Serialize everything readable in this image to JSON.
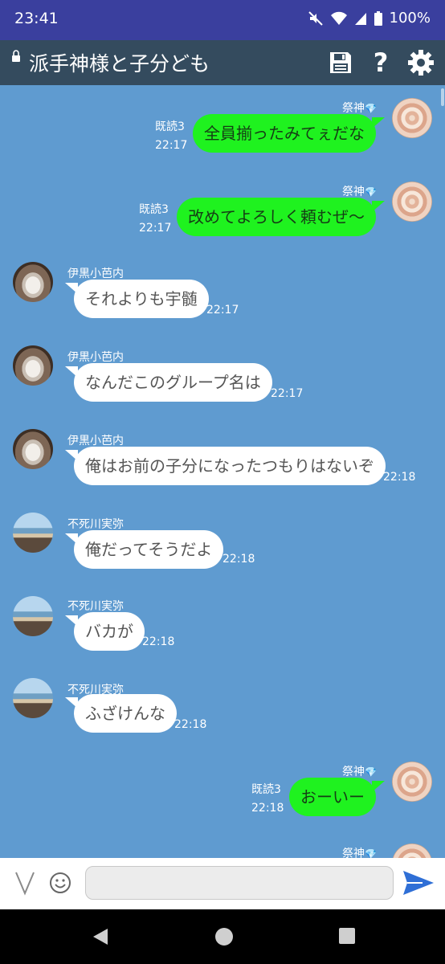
{
  "status_bar": {
    "time": "23:41",
    "battery": "100%"
  },
  "header": {
    "title": "派手神様と子分ども"
  },
  "messages": [
    {
      "type": "outgoing",
      "sender": "祭神",
      "gem": "💎",
      "text": "全員揃ったみてぇだな",
      "read": "既読3",
      "time": "22:17",
      "avatar": "flower"
    },
    {
      "type": "outgoing",
      "sender": "祭神",
      "gem": "💎",
      "text": "改めてよろしく頼むぜ〜",
      "read": "既読3",
      "time": "22:17",
      "avatar": "flower"
    },
    {
      "type": "incoming",
      "sender": "伊黒小芭内",
      "text": "それよりも宇髄",
      "time": "22:17",
      "avatar": "cup"
    },
    {
      "type": "incoming",
      "sender": "伊黒小芭内",
      "text": "なんだこのグループ名は",
      "time": "22:17",
      "avatar": "cup"
    },
    {
      "type": "incoming",
      "sender": "伊黒小芭内",
      "text": "俺はお前の子分になったつもりはないぞ",
      "time": "22:18",
      "avatar": "cup"
    },
    {
      "type": "incoming",
      "sender": "不死川実弥",
      "text": "俺だってそうだよ",
      "time": "22:18",
      "avatar": "beach"
    },
    {
      "type": "incoming",
      "sender": "不死川実弥",
      "text": "バカが",
      "time": "22:18",
      "avatar": "beach"
    },
    {
      "type": "incoming",
      "sender": "不死川実弥",
      "text": "ふざけんな",
      "time": "22:18",
      "avatar": "beach"
    },
    {
      "type": "outgoing",
      "sender": "祭神",
      "gem": "💎",
      "text": "おーいー",
      "read": "既読3",
      "time": "22:18",
      "avatar": "flower"
    },
    {
      "type": "outgoing-partial",
      "sender": "祭神",
      "gem": "💎",
      "avatar": "flower"
    }
  ],
  "composer": {
    "placeholder": ""
  },
  "icons": {
    "header": [
      "lock-icon",
      "save-icon",
      "help-icon",
      "settings-icon"
    ],
    "composer": [
      "chevron-down-icon",
      "emoji-icon",
      "send-icon"
    ],
    "nav": [
      "back-icon",
      "home-icon",
      "recents-icon"
    ]
  },
  "colors": {
    "status_bar": "#3a3f9e",
    "app_bar": "#344b5e",
    "chat_background": "#5f9bd0",
    "outgoing_bubble": "#1ff21f",
    "incoming_bubble": "#ffffff",
    "send_icon": "#2f6fd6"
  }
}
